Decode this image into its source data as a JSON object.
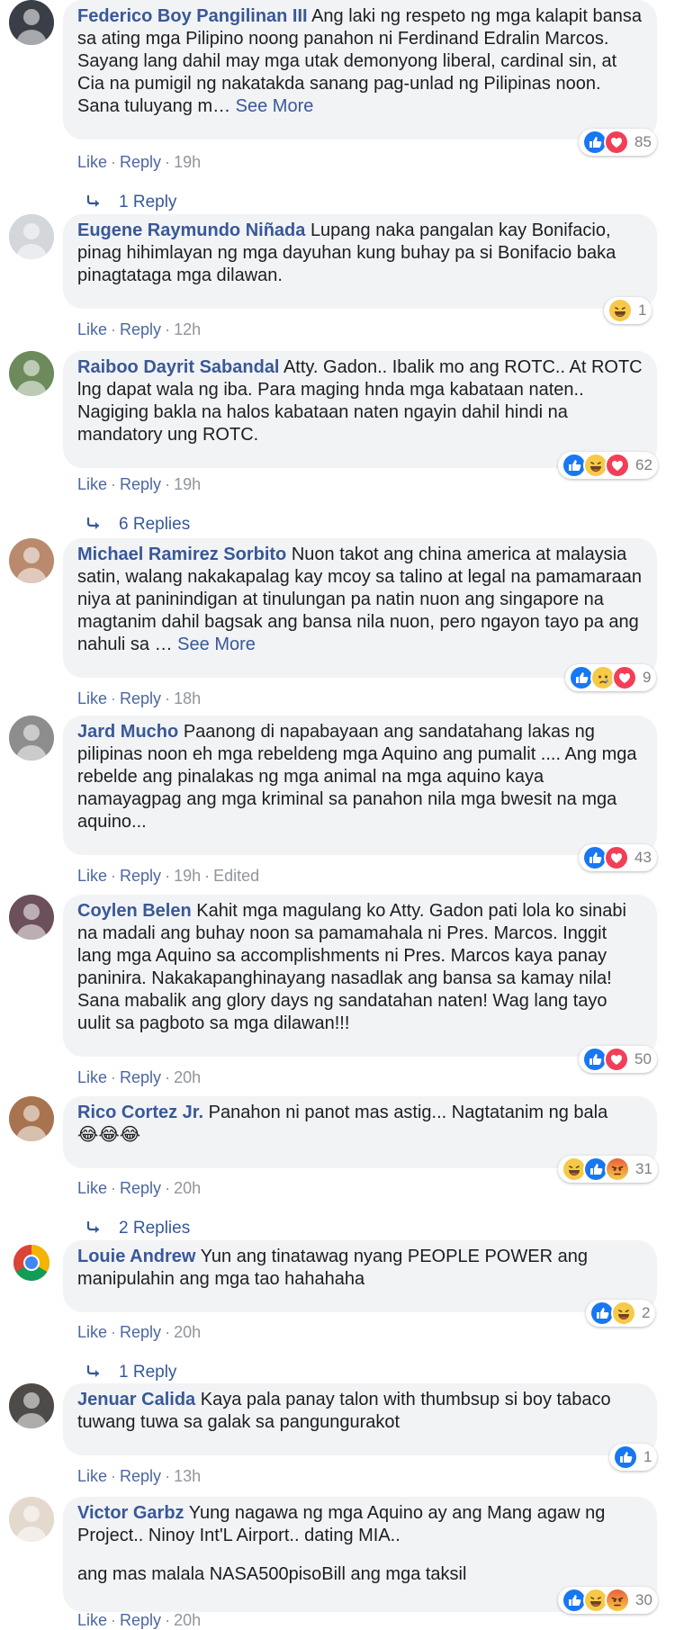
{
  "actions": {
    "like": "Like",
    "reply": "Reply",
    "dot": "·",
    "edited": "Edited"
  },
  "see_more": "See More",
  "comments": [
    {
      "author": "Federico Boy Pangilinan III",
      "text": "Ang laki ng respeto ng mga kalapit bansa sa ating mga Pilipino noong panahon ni Ferdinand Edralin Marcos. Sayang lang dahil may mga utak demonyong liberal, cardinal sin, at Cia na pumigil ng nakatakda sanang pag-unlad ng Pilipinas noon. Sana tuluyang m… ",
      "see_more": true,
      "time": "19h",
      "reactions": [
        "like",
        "love"
      ],
      "reaction_count": "85",
      "replies": "1 Reply",
      "avatar_color": "#3a3f47"
    },
    {
      "author": "Eugene Raymundo Niñada",
      "text": "Lupang naka pangalan kay Bonifacio, pinag hihimlayan ng mga dayuhan kung buhay pa si Bonifacio baka pinagtataga mga dilawan.",
      "time": "12h",
      "reactions": [
        "haha"
      ],
      "reaction_count": "1",
      "avatar_color": "#d3d6db"
    },
    {
      "author": "Raiboo Dayrit Sabandal",
      "text": "Atty. Gadon.. Ibalik mo ang ROTC.. At ROTC lng dapat wala ng iba. Para maging hnda mga kabataan naten.. Nagiging bakla na halos kabataan naten ngayin dahil hindi na mandatory ung ROTC.",
      "time": "19h",
      "reactions": [
        "like",
        "haha",
        "love"
      ],
      "reaction_count": "62",
      "replies": "6 Replies",
      "avatar_color": "#6d8a5a"
    },
    {
      "author": "Michael Ramirez Sorbito",
      "text": "Nuon takot ang china america at malaysia satin, walang nakakapalag kay mcoy sa talino at legal na pamamaraan niya at paninindigan at tinulungan pa natin nuon ang singapore na magtanim dahil bagsak ang bansa nila nuon, pero ngayon tayo pa ang nahuli sa … ",
      "see_more": true,
      "time": "18h",
      "reactions": [
        "like",
        "sad",
        "love"
      ],
      "reaction_count": "9",
      "avatar_color": "#b98a6e"
    },
    {
      "author": "Jard Mucho",
      "text": "Paanong di napabayaan ang sandatahang lakas ng pilipinas noon eh mga rebeldeng mga Aquino ang pumalit .... Ang mga rebelde ang pinalakas ng mga animal na mga aquino kaya namayagpag ang mga kriminal sa panahon nila mga bwesit na mga aquino...",
      "time": "19h",
      "edited": true,
      "reactions": [
        "like",
        "love"
      ],
      "reaction_count": "43",
      "avatar_color": "#8d8d8d"
    },
    {
      "author": "Coylen Belen",
      "text": "Kahit mga magulang ko Atty. Gadon pati lola ko sinabi na madali ang buhay noon sa pamamahala ni Pres. Marcos. Inggit lang mga Aquino sa accomplishments ni Pres. Marcos kaya panay paninira. Nakakapanghinayang nasadlak ang bansa sa kamay nila! Sana mabalik ang glory days ng sandatahan naten! Wag lang tayo uulit sa pagboto sa mga dilawan!!!",
      "time": "20h",
      "reactions": [
        "like",
        "love"
      ],
      "reaction_count": "50",
      "avatar_color": "#6b4f5a"
    },
    {
      "author": "Rico Cortez Jr.",
      "text": "Panahon ni panot mas astig... Nagtatanim ng bala",
      "emojis": "😂😂😂",
      "time": "20h",
      "reactions": [
        "haha",
        "like",
        "angry"
      ],
      "reaction_count": "31",
      "replies": "2 Replies",
      "avatar_color": "#a8734f"
    },
    {
      "author": "Louie Andrew",
      "text": "Yun ang tinatawag nyang PEOPLE POWER ang manipulahin ang mga tao hahahaha",
      "time": "20h",
      "reactions": [
        "like",
        "haha"
      ],
      "reaction_count": "2",
      "replies": "1 Reply",
      "avatar_icon": "chrome"
    },
    {
      "author": "Jenuar Calida",
      "text": "Kaya pala panay talon with thumbsup si boy tabaco tuwang tuwa sa galak sa pangungurakot",
      "time": "13h",
      "reactions": [
        "like"
      ],
      "reaction_count": "1",
      "avatar_color": "#4d4a48"
    },
    {
      "author": "Victor Garbz",
      "text": "Yung nagawa ng mga Aquino ay ang Mang agaw ng Project.. Ninoy Int'L Airport.. dating MIA..",
      "text2": "ang mas malala NASA500pisoBill ang mga taksil",
      "time": "20h",
      "reactions": [
        "like",
        "haha",
        "angry"
      ],
      "reaction_count": "30",
      "avatar_color": "#e4d9cf"
    }
  ]
}
